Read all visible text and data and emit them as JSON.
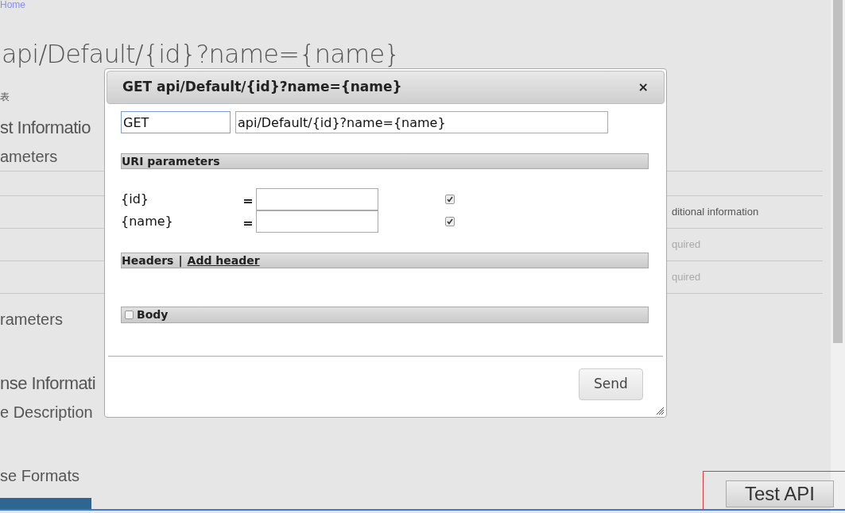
{
  "page": {
    "breadcrumb": "Home",
    "title": "api/Default/{id}?name={name}",
    "subtitle": "表",
    "request_heading": "st Informatio",
    "uri_heading": "ameters",
    "table": {
      "header": "ditional information",
      "rows": [
        "quired",
        "quired"
      ]
    },
    "body_heading": "rameters",
    "response_heading": "nse Informati",
    "description_heading": "e Description",
    "formats_heading": "se Formats"
  },
  "dialog": {
    "title": "GET api/Default/{id}?name={name}",
    "close": "×",
    "method": "GET",
    "url": "api/Default/{id}?name={name}",
    "uri_section": "URI parameters",
    "parameters": [
      {
        "name": "{id}",
        "equals": "=",
        "checked": true
      },
      {
        "name": "{name}",
        "equals": "=",
        "checked": true
      }
    ],
    "headers_section": {
      "label": "Headers",
      "separator": "|",
      "link": "Add header"
    },
    "body_section": {
      "label": "Body",
      "checked": false
    },
    "send": "Send"
  },
  "test_api": "Test API"
}
